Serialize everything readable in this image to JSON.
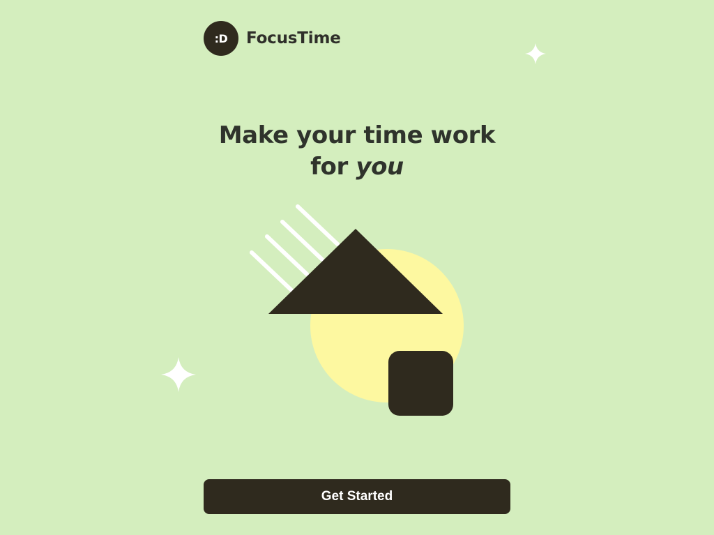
{
  "brand": {
    "logo_text": ":D",
    "name": "FocusTime"
  },
  "headline": {
    "line1": "Make your time work",
    "line2_prefix": "for ",
    "line2_emphasis": "you"
  },
  "cta": {
    "label": "Get Started"
  },
  "colors": {
    "background": "#d4eebe",
    "dark": "#2f2a1e",
    "sun": "#fdf8a0",
    "white": "#ffffff"
  },
  "icons": {
    "sparkle_large": "four-point-star",
    "sparkle_small": "four-point-star"
  }
}
